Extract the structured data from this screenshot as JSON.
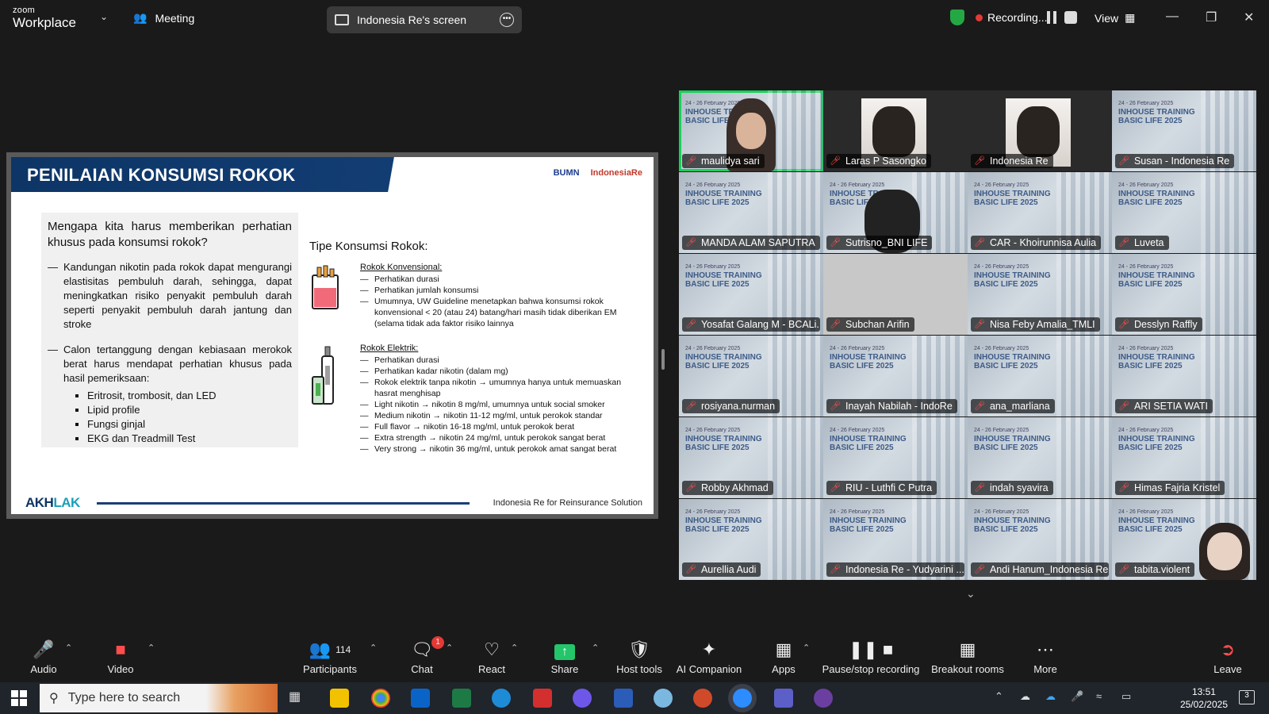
{
  "app": {
    "brand_top": "zoom",
    "brand_bottom": "Workplace",
    "meeting_label": "Meeting"
  },
  "share_pill": {
    "label": "Indonesia Re's screen"
  },
  "recording": {
    "label": "Recording..."
  },
  "view": {
    "label": "View"
  },
  "slide": {
    "title": "PENILAIAN KONSUMSI ROKOK",
    "logo_bumn": "BUMN",
    "logo_indonesiare": "IndonesiaRe",
    "question": "Mengapa kita harus memberikan perhatian khusus pada konsumsi rokok?",
    "point1": "Kandungan nikotin pada rokok dapat mengurangi elastisitas pembuluh darah, sehingga, dapat meningkatkan risiko penyakit pembuluh darah seperti penyakit pembuluh darah jantung dan stroke",
    "point2": "Calon tertanggung dengan kebiasaan merokok berat harus mendapat perhatian khusus pada hasil pemeriksaan:",
    "bullets": [
      "Eritrosit, trombosit, dan LED",
      "Lipid profile",
      "Fungsi ginjal",
      "EKG dan Treadmill Test"
    ],
    "tipe_title": "Tipe Konsumsi Rokok:",
    "konvensional_title": "Rokok Konvensional:",
    "konvensional_items": [
      "Perhatikan durasi",
      "Perhatikan jumlah konsumsi",
      "Umumnya, UW Guideline menetapkan bahwa konsumsi rokok konvensional < 20 (atau 24) batang/hari masih tidak diberikan EM (selama tidak ada faktor risiko lainnya"
    ],
    "elektrik_title": "Rokok Elektrik:",
    "elektrik_items": [
      "Perhatikan durasi",
      "Perhatikan kadar nikotin (dalam mg)",
      "Rokok elektrik tanpa nikotin → umumnya hanya untuk memuaskan hasrat menghisap",
      "Light nikotin → nikotin 8 mg/ml, umumnya untuk social smoker",
      "Medium nikotin → nikotin 11-12 mg/ml, untuk perokok standar",
      "Full flavor → nikotin 16-18 mg/ml, untuk perokok berat",
      "Extra strength → nikotin 24 mg/ml, untuk perokok sangat berat",
      "Very strong → nikotin 36 mg/ml, untuk perokok amat sangat berat"
    ],
    "footer_brand_a": "AKH",
    "footer_brand_b": "LAK",
    "footer_text": "Indonesia Re for Reinsurance Solution"
  },
  "tile_background": {
    "line1": "INHOUSE TRAINING",
    "line2": "BASIC LIFE 2025",
    "line3": "24 - 26 February 2025"
  },
  "participants_grid": [
    {
      "name": "maulidya sari",
      "kind": "video-hijab",
      "active": true
    },
    {
      "name": "Laras P Sasongko",
      "kind": "photo"
    },
    {
      "name": "Indonesia Re",
      "kind": "photo"
    },
    {
      "name": "Susan - Indonesia Re",
      "kind": "bg"
    },
    {
      "name": "MANDA ALAM SAPUTRA",
      "kind": "bg"
    },
    {
      "name": "Sutrisno_BNI LIFE",
      "kind": "video-dark"
    },
    {
      "name": "CAR - Khoirunnisa Aulia",
      "kind": "bg"
    },
    {
      "name": "Luveta",
      "kind": "bg"
    },
    {
      "name": "Yosafat Galang M - BCALi...",
      "kind": "bg"
    },
    {
      "name": "Subchan Arifin",
      "kind": "gray"
    },
    {
      "name": "Nisa Feby Amalia_TMLI",
      "kind": "bg"
    },
    {
      "name": "Desslyn Raffly",
      "kind": "bg"
    },
    {
      "name": "rosiyana.nurman",
      "kind": "bg"
    },
    {
      "name": "Inayah Nabilah - IndoRe",
      "kind": "bg"
    },
    {
      "name": "ana_marliana",
      "kind": "bg"
    },
    {
      "name": "ARI SETIA WATI",
      "kind": "bg"
    },
    {
      "name": "Robby Akhmad",
      "kind": "bg"
    },
    {
      "name": "RIU - Luthfi C Putra",
      "kind": "bg"
    },
    {
      "name": "indah syavira",
      "kind": "bg"
    },
    {
      "name": "Himas Fajria Kristel",
      "kind": "bg"
    },
    {
      "name": "Aurellia Audi",
      "kind": "bg"
    },
    {
      "name": "Indonesia Re - Yudyarini ...",
      "kind": "bg"
    },
    {
      "name": "Andi Hanum_Indonesia Re",
      "kind": "bg"
    },
    {
      "name": "tabita.violent",
      "kind": "bg-person"
    }
  ],
  "toolbar": {
    "audio": "Audio",
    "video": "Video",
    "participants": "Participants",
    "participants_count": "114",
    "chat": "Chat",
    "chat_badge": "1",
    "react": "React",
    "share": "Share",
    "host_tools": "Host tools",
    "ai_companion": "AI Companion",
    "apps": "Apps",
    "pause_recording": "Pause/stop recording",
    "breakout_rooms": "Breakout rooms",
    "more": "More",
    "leave": "Leave"
  },
  "taskbar": {
    "search_placeholder": "Type here to search",
    "time": "13:51",
    "date": "25/02/2025",
    "notif_count": "3"
  },
  "colors": {
    "active_speaker": "#19d05a",
    "muted": "#ff4d4d",
    "slide_navy": "#0d3566",
    "share_green": "#24c56b"
  }
}
